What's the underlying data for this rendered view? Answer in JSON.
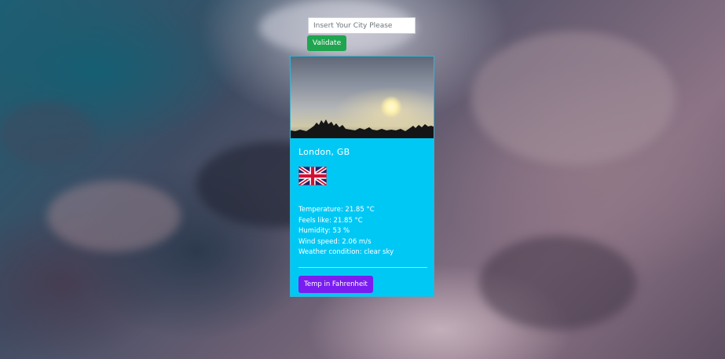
{
  "search": {
    "placeholder": "Insert Your City Please",
    "value": ""
  },
  "buttons": {
    "validate_label": "Validate",
    "fahrenheit_label": "Temp in Fahrenheit"
  },
  "weather_card": {
    "city": "London, GB",
    "flag_icon": "uk-flag-icon",
    "image_icon": "sunset-sky-photo",
    "temperature": "Temperature: 21.85 °C",
    "feels_like": "Feels like: 21.85 °C",
    "humidity": "Humidity: 53 %",
    "wind_speed": "Wind speed: 2.06 m/s",
    "condition": "Weather condition: clear sky"
  },
  "colors": {
    "card_background": "#00c8f5",
    "validate_button": "#1fa54f",
    "fahrenheit_button": "#7a1df0"
  }
}
